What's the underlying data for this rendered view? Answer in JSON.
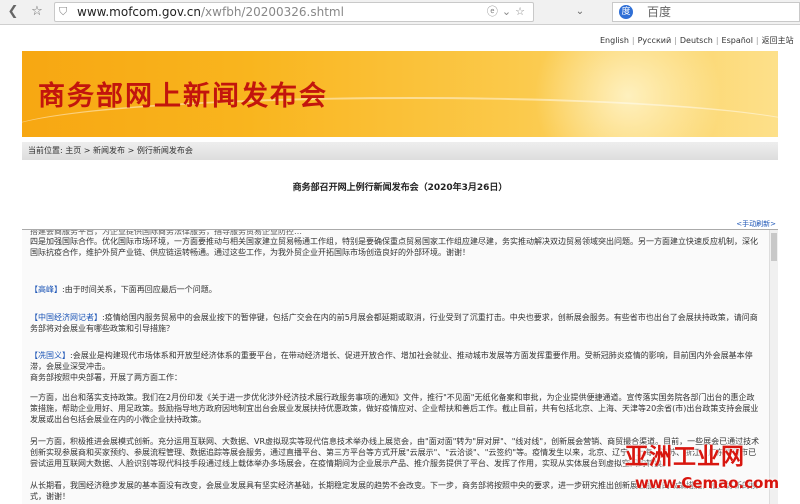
{
  "browser": {
    "url_host": "www.mofcom.gov.cn",
    "url_path": "/xwfbh/20200326.shtml",
    "search_placeholder": "百度",
    "icons": [
      "back-icon",
      "favorite-icon",
      "shield-icon",
      "ie-mode-icon",
      "star-icon",
      "dropdown-icon",
      "baidu-icon"
    ]
  },
  "header": {
    "languages": [
      "English",
      "Русский",
      "Deutsch",
      "Español",
      "返回主站"
    ],
    "banner_title": "商务部网上新闻发布会"
  },
  "breadcrumb": {
    "prefix": "当前位置: ",
    "items": [
      "主页",
      "新闻发布",
      "例行新闻发布会"
    ]
  },
  "article": {
    "title": "商务部召开网上例行新闻发布会（2020年3月26日）",
    "refresh_label": "<手动刷新>",
    "partial_top": "搭建会商服务平台，为企业提供国际商务法律服务，指导服务贸易企业防控…",
    "p1": "四是加强国际合作。优化国际市场环境，一方面要推动与相关国家建立贸易畅通工作组，特别是要确保重点贸易国家工作组应建尽建，务实推动解决双边贸易领域突出问题。另一方面建立快速反应机制，深化国际抗疫合作，维护外贸产业链、供应链运转畅通。通过这些工作，为我外贸企业开拓国际市场创造良好的外部环境。谢谢！",
    "p2_speaker": "【高峰】",
    "p2": ":由于时间关系，下面再回应最后一个问题。",
    "p3_speaker": "【中国经济网记者】",
    "p3": ":疫情给国内服务贸易中的会展业按下的暂停键，包括广交会在内的前5月展会都延期或取消，行业受到了沉重打击。中央也要求，创新展会服务。有些省市也出台了会展扶持政策，请问商务部将对会展业有哪些政策和引导措施？",
    "p4_speaker": "【冼国义】",
    "p4": ":会展业是构建现代市场体系和开放型经济体系的重要平台，在带动经济增长、促进开放合作、增加社会就业、推动城市发展等方面发挥重要作用。受新冠肺炎疫情的影响，目前国内外会展基本停滞，会展业深受冲击。",
    "p4b": "商务部按照中央部署，开展了两方面工作：",
    "p5": "一方面，出台和落实支持政策。我们在2月份印发《关于进一步优化涉外经济技术展行政服务事项的通知》文件，推行\"不见面\"无纸化备案和审批，为企业提供便捷通道。宣传落实国务院各部门出台的惠企政策措施，帮助企业用好、用足政策。鼓励指导地方政府因地制宜出台会展业发展扶持优惠政策，做好疫情应对、企业帮扶和善后工作。截止目前，共有包括北京、上海、天津等20余省(市)出台政策支持会展业发展或出台包括会展业在内的小微企业扶持政策。",
    "p6": "另一方面，积极推进会展模式创新。充分运用互联网、大数据、VR虚拟现实等现代信息技术举办线上展览会，由\"面对面\"转为\"屏对屏\"、\"线对线\"，创新展会营销、商贸撮合渠道。目前，一些展会已通过技术创新实现参展商和买家预约、参展流程管理、数据追踪等展会服务，通过直播平台、第三方平台等方式开展\"云展示\"、\"云洽谈\"、\"云签约\"等。疫情发生以来，北京、辽宁、上海、江苏、浙江、广东等省市已尝试运用互联网大数据、人脸识别等现代科技手段通过线上载体举办多场展会，在疫情期间为企业展示产品、推介服务提供了平台、发挥了作用，实现从实体展台到虚拟空间的转换。",
    "p7": "从长期看，我国经济稳步发展的基本面没有改变，会展业发展具有坚实经济基础，长期稳定发展的趋势不会改变。下一步，商务部将按照中央的要求，进一步研究推出创新展会服务的政策措施，推广好新的模式，谢谢！"
  },
  "watermark": {
    "cn": "亚洲工业网",
    "url": "www.Cemao.com"
  }
}
